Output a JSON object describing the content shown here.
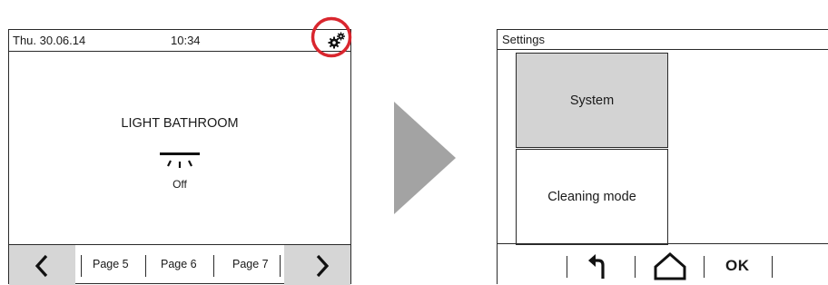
{
  "home_screen": {
    "header": {
      "date": "Thu. 30.06.14",
      "time": "10:34",
      "settings_icon": "gears-icon"
    },
    "highlight_color": "#d9262e",
    "content": {
      "title": "LIGHT BATHROOM",
      "light_icon": "ceiling-light-icon",
      "status": "Off"
    },
    "footer": {
      "prev_icon": "chevron-left-icon",
      "pages": [
        "Page 5",
        "Page 6",
        "Page 7"
      ],
      "next_icon": "chevron-right-icon"
    }
  },
  "transition_arrow": {
    "icon": "play-triangle-icon",
    "color": "#a3a3a3"
  },
  "settings_screen": {
    "header": {
      "title": "Settings"
    },
    "tiles": [
      {
        "label": "System",
        "selected": true,
        "fill": "#d3d3d3"
      },
      {
        "label": "Cleaning mode",
        "selected": false
      }
    ],
    "footer": {
      "back_icon": "return-arrow-icon",
      "home_icon": "home-icon",
      "ok_label": "OK"
    }
  }
}
